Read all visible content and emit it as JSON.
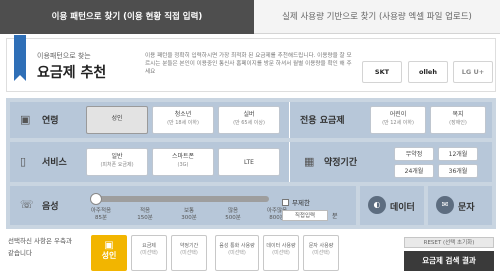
{
  "tabs": {
    "active": "이용 패턴으로 찾기 (이용 현황 직접 입력)",
    "inactive": "실제 사용량 기반으로 찾기 (사용량 엑셀 파일 업로드)"
  },
  "header": {
    "subtitle": "이용패턴으로 찾는",
    "title": "요금제 추천",
    "description": "이용 패턴을 정확히 입력하시면 가장 최적화 된 요금제를 추천해드립니다. 이용량을 잘 모르시는 분들은 본인이 이용중인 통신사 홈페이지를 방문 하셔서 월별 이용량을 확인 해 주세요",
    "carriers": [
      "SKT",
      "olleh",
      "LG U+"
    ]
  },
  "age": {
    "label": "연령",
    "options": [
      {
        "label": "성인",
        "sub": ""
      },
      {
        "label": "청소년",
        "sub": "(만 18세 이하)"
      },
      {
        "label": "실버",
        "sub": "(만 65세 이상)"
      }
    ],
    "selected": "성인"
  },
  "dedicated": {
    "label": "전용 요금제",
    "options": [
      {
        "label": "어린이",
        "sub": "(만 12세 이하)"
      },
      {
        "label": "복지",
        "sub": "(장애인)"
      }
    ]
  },
  "service": {
    "label": "서비스",
    "options": [
      {
        "label": "일반",
        "sub": "(피처폰 요금제)"
      },
      {
        "label": "스마트폰",
        "sub": "(3G)"
      },
      {
        "label": "LTE",
        "sub": ""
      }
    ]
  },
  "contract": {
    "label": "약정기간",
    "options": [
      "무약정",
      "12개월",
      "24개월",
      "36개월"
    ]
  },
  "voice": {
    "label": "음성",
    "ticks": [
      {
        "label": "아주적음",
        "value": "85분"
      },
      {
        "label": "적음",
        "value": "150분"
      },
      {
        "label": "보통",
        "value": "300분"
      },
      {
        "label": "많음",
        "value": "500분"
      },
      {
        "label": "아주많음",
        "value": "800분"
      }
    ],
    "unlimited_label": "무제한",
    "direct_input": "직접입력",
    "unit": "분"
  },
  "data_label": "데이터",
  "sms_label": "문자",
  "bottom": {
    "prompt": "선택하신 사항은 우측과 같습니다",
    "steps": [
      {
        "label": "성인",
        "sub": ""
      },
      {
        "label": "요금제",
        "sub": "(미선택)"
      },
      {
        "label": "약정기간",
        "sub": "(미선택)"
      },
      {
        "label": "음성 통화 사용량",
        "sub": "(미선택)"
      },
      {
        "label": "데이터 사용량",
        "sub": "(미선택)"
      },
      {
        "label": "문자 사용량",
        "sub": "(미선택)"
      }
    ],
    "reset": "RESET (선택 초기화)",
    "result": "요금제 검색 결과"
  }
}
